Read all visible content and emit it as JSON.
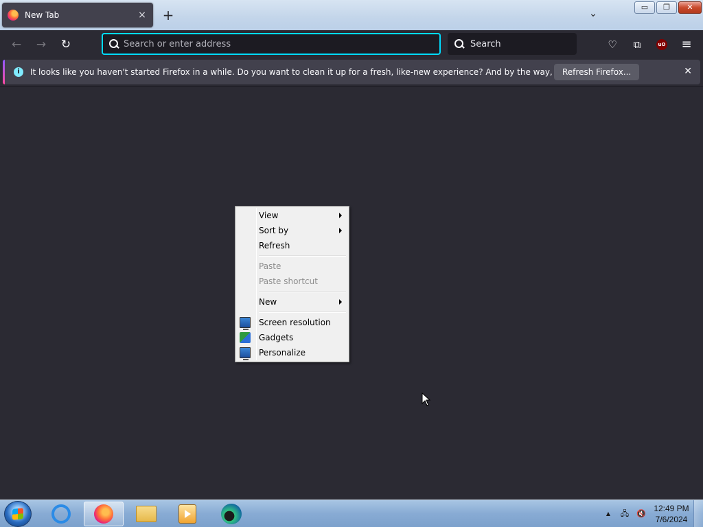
{
  "browser": {
    "tab": {
      "title": "New Tab",
      "close": "×"
    },
    "new_tab": "+",
    "tab_list": "⌄",
    "window_buttons": {
      "minimize": "▭",
      "restore": "❐",
      "close": "✕"
    },
    "toolbar": {
      "back": "←",
      "forward": "→",
      "reload": "↻",
      "url_placeholder": "Search or enter address",
      "search_label": "Search",
      "pocket": "♡",
      "extensions": "⧉",
      "ublock": "uO",
      "menu": "≡"
    },
    "notification": {
      "text": "It looks like you haven't started Firefox in a while. Do you want to clean it up for a fresh, like-new experience? And by the way, welcome back!",
      "button": "Refresh Firefox...",
      "close": "✕",
      "info": "i"
    }
  },
  "context_menu": {
    "items": [
      {
        "label": "View",
        "submenu": true
      },
      {
        "label": "Sort by",
        "submenu": true
      },
      {
        "label": "Refresh"
      },
      {
        "label": "Paste",
        "disabled": true
      },
      {
        "label": "Paste shortcut",
        "disabled": true
      },
      {
        "label": "New",
        "submenu": true
      },
      {
        "label": "Screen resolution",
        "icon": "monitor-icon"
      },
      {
        "label": "Gadgets",
        "icon": "gadgets-icon"
      },
      {
        "label": "Personalize",
        "icon": "personalize-icon"
      }
    ]
  },
  "taskbar": {
    "apps": [
      "internet-explorer",
      "firefox",
      "windows-explorer",
      "media-player",
      "edge"
    ],
    "active_app": "firefox",
    "tray": {
      "show_hidden": "▲",
      "network": "🖧",
      "volume": "🔇"
    },
    "clock": {
      "time": "12:49 PM",
      "date": "7/6/2024"
    }
  }
}
